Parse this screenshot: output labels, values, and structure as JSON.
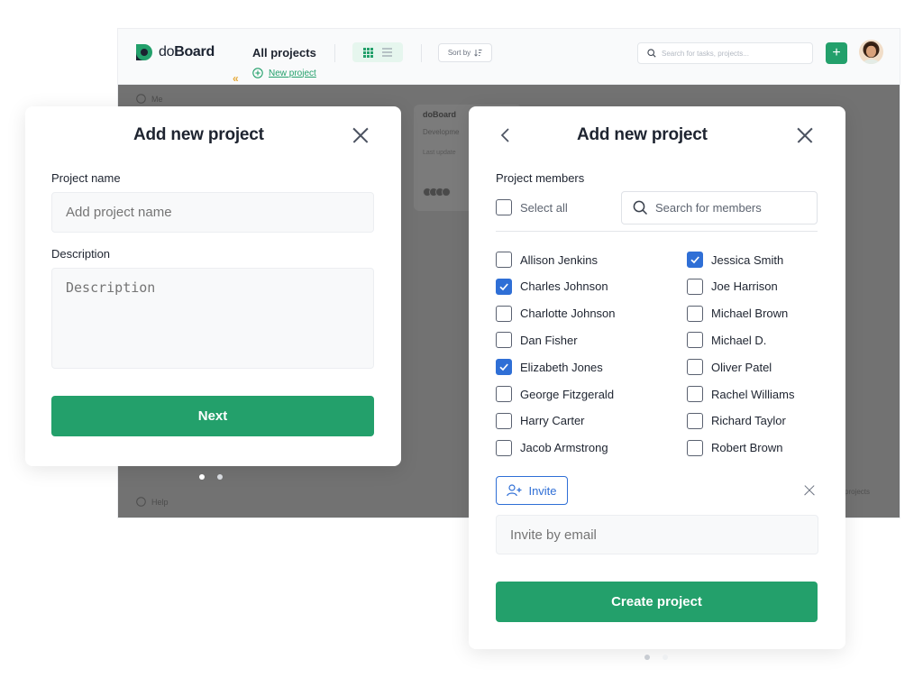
{
  "app": {
    "logo": {
      "do": "do",
      "board": "Board"
    },
    "page_title": "All projects",
    "new_project_label": "New project",
    "collapse_glyph": "«",
    "sort_label": "Sort by",
    "search_placeholder": "Search for tasks, projects...",
    "plus_glyph": "+",
    "sidebar": {
      "me": "Me",
      "help": "Help"
    },
    "ghost_card": {
      "title": "doBoard",
      "subtitle": "Developme",
      "updated": "Last update"
    },
    "ghost_right": "projects",
    "colors": {
      "accent": "#23a06b",
      "checkbox": "#2f6fd6",
      "overlay": "#727272"
    }
  },
  "modal_details": {
    "title": "Add new project",
    "project_name_label": "Project name",
    "project_name_placeholder": "Add project name",
    "description_label": "Description",
    "description_placeholder": "Description",
    "next_label": "Next",
    "step": 1,
    "steps_total": 2
  },
  "modal_members": {
    "title": "Add new project",
    "section_label": "Project members",
    "select_all_label": "Select all",
    "search_placeholder": "Search for members",
    "members_left": [
      {
        "name": "Allison Jenkins",
        "checked": false
      },
      {
        "name": "Charles Johnson",
        "checked": true
      },
      {
        "name": "Charlotte Johnson",
        "checked": false
      },
      {
        "name": "Dan Fisher",
        "checked": false
      },
      {
        "name": "Elizabeth Jones",
        "checked": true
      },
      {
        "name": "George Fitzgerald",
        "checked": false
      },
      {
        "name": "Harry Carter",
        "checked": false
      },
      {
        "name": "Jacob Armstrong",
        "checked": false
      }
    ],
    "members_right": [
      {
        "name": "Jessica Smith",
        "checked": true
      },
      {
        "name": "Joe Harrison",
        "checked": false
      },
      {
        "name": "Michael Brown",
        "checked": false
      },
      {
        "name": "Michael D.",
        "checked": false
      },
      {
        "name": "Oliver Patel",
        "checked": false
      },
      {
        "name": "Rachel Williams",
        "checked": false
      },
      {
        "name": "Richard Taylor",
        "checked": false
      },
      {
        "name": "Robert Brown",
        "checked": false
      }
    ],
    "invite_label": "Invite",
    "invite_placeholder": "Invite by email",
    "create_label": "Create project",
    "step": 2,
    "steps_total": 2
  }
}
